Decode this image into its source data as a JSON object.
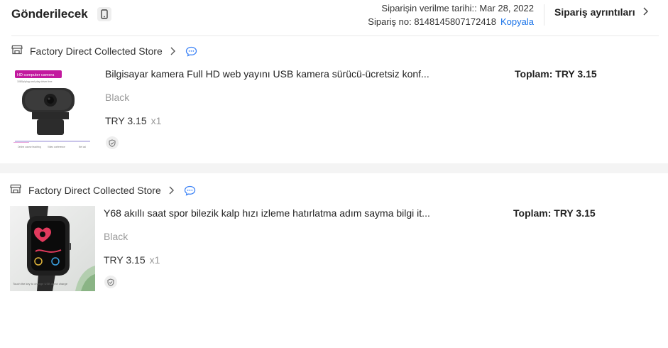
{
  "header": {
    "status": "Gönderilecek",
    "order_date": "Siparişin verilme tarihi:: Mar 28, 2022",
    "order_no": "Sipariş no: 8148145807172418",
    "copy_label": "Kopyala",
    "details_label": "Sipariş ayrıntıları"
  },
  "icons": {
    "phone": "phone-icon",
    "store": "store-icon",
    "chevron": "chevron-right-icon",
    "chat": "chat-icon",
    "shield": "shield-icon"
  },
  "colors": {
    "link": "#1a73e8",
    "chat": "#3b82f6",
    "divider_band": "#f4f4f4"
  },
  "orders": [
    {
      "store": "Factory Direct Collected Store",
      "thumb_text": {
        "badge": "HD computer camera",
        "sub": "1080p/plug and play driver free",
        "captions": [
          "Online course teaching",
          "Video conference",
          "Net cal"
        ]
      },
      "title": "Bilgisayar kamera Full HD web yayını USB kamera sürücü-ücretsiz konf...",
      "variant": "Black",
      "price": "TRY 3.15",
      "qty": "x1",
      "total": "Toplam: TRY 3.15"
    },
    {
      "store": "Factory Direct Collected Store",
      "thumb_text": {
        "caption": "Touch the key to change\nUSB direct charge"
      },
      "title": "Y68 akıllı saat spor bilezik kalp hızı izleme hatırlatma adım sayma bilgi it...",
      "variant": "Black",
      "price": "TRY 3.15",
      "qty": "x1",
      "total": "Toplam: TRY 3.15"
    }
  ]
}
